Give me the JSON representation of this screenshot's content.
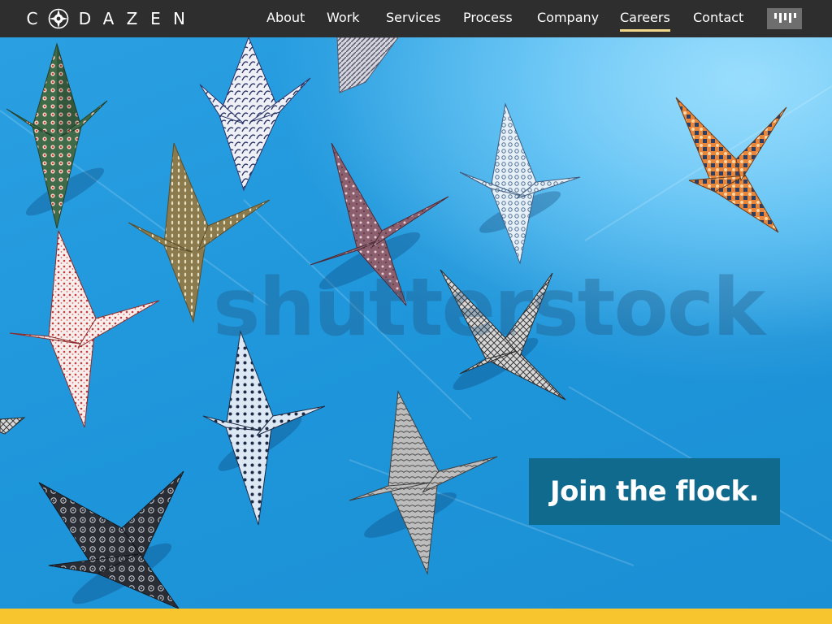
{
  "brand": {
    "letters": [
      "C",
      "D",
      "A",
      "Z",
      "E",
      "N"
    ]
  },
  "nav": {
    "links": [
      {
        "label": "About",
        "active": false
      },
      {
        "label": "Work",
        "active": false
      },
      {
        "label": "Services",
        "active": false
      },
      {
        "label": "Process",
        "active": false
      },
      {
        "label": "Company",
        "active": false
      },
      {
        "label": "Careers",
        "active": true
      },
      {
        "label": "Contact",
        "active": false
      }
    ],
    "menu_icon": "menu-icon"
  },
  "hero": {
    "image": "origami-cranes-on-blue-background",
    "watermark": "shutterstock",
    "banner_text": "Join the flock."
  },
  "colors": {
    "nav_bg": "#2e2e2e",
    "active_underline": "#f1d78a",
    "banner_bg": "#0f6a8d",
    "hero_blue": "#1f9be0",
    "bottom_strip": "#f7c52e"
  }
}
